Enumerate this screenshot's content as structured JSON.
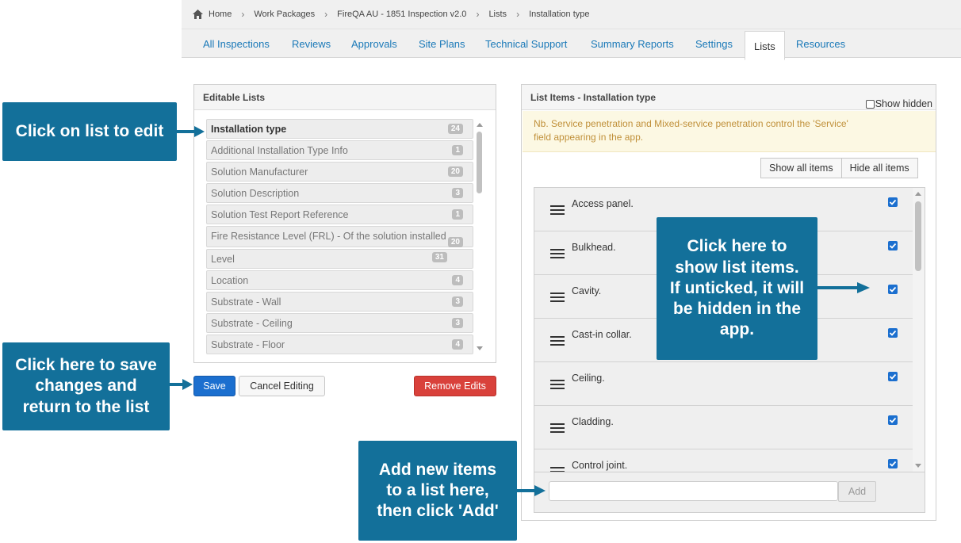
{
  "breadcrumb": {
    "items": [
      "Home",
      "Work Packages",
      "FireQA AU - 1851 Inspection v2.0",
      "Lists",
      "Installation type"
    ]
  },
  "tabs": [
    "All Inspections",
    "Reviews",
    "Approvals",
    "Site Plans",
    "Technical Support",
    "Summary Reports",
    "Settings",
    "Lists",
    "Resources"
  ],
  "active_tab": "Lists",
  "left_panel": {
    "title": "Editable Lists",
    "items": [
      {
        "label": "Installation type",
        "count": "24"
      },
      {
        "label": "Additional Installation Type Info",
        "count": "1"
      },
      {
        "label": "Solution Manufacturer",
        "count": "20"
      },
      {
        "label": "Solution Description",
        "count": "3"
      },
      {
        "label": "Solution Test Report Reference",
        "count": "1"
      },
      {
        "label": "Fire Resistance Level (FRL) - Of the solution installed",
        "count": "20"
      },
      {
        "label": "Level",
        "count": "31"
      },
      {
        "label": "Location",
        "count": "4"
      },
      {
        "label": "Substrate - Wall",
        "count": "3"
      },
      {
        "label": "Substrate - Ceiling",
        "count": "3"
      },
      {
        "label": "Substrate - Floor",
        "count": "4"
      }
    ]
  },
  "buttons": {
    "save": "Save",
    "cancel": "Cancel Editing",
    "remove": "Remove Edits"
  },
  "right_panel": {
    "title": "List Items - Installation type",
    "show_hidden_label": "Show hidden",
    "show_hidden_checked": false,
    "note_line1": "Nb. Service penetration and Mixed-service penetration control the 'Service'",
    "note_line2": "field appearing in the app.",
    "show_all": "Show all items",
    "hide_all": "Hide all items",
    "items": [
      {
        "label": "Access panel.",
        "checked": true
      },
      {
        "label": "Bulkhead.",
        "checked": true
      },
      {
        "label": "Cavity.",
        "checked": true
      },
      {
        "label": "Cast-in collar.",
        "checked": true
      },
      {
        "label": "Ceiling.",
        "checked": true
      },
      {
        "label": "Cladding.",
        "checked": true
      },
      {
        "label": "Control joint.",
        "checked": true
      }
    ],
    "add_input_value": "",
    "add_button": "Add"
  },
  "callouts": {
    "edit_list": "Click on list to edit",
    "save": [
      "Click here to save",
      "changes and",
      "return to the list"
    ],
    "show_items": [
      "Click here to",
      "show list items.",
      "If unticked, it will",
      "be hidden in the",
      "app."
    ],
    "add_items": [
      "Add new items",
      "to a list here,",
      "then click 'Add'"
    ]
  },
  "colors": {
    "callout_bg": "#13709a",
    "link_blue": "#1a79b8",
    "save_blue": "#1b6fcf",
    "remove_red": "#d9413b",
    "note_bg": "#fcf8e3",
    "note_text": "#c0903a"
  }
}
